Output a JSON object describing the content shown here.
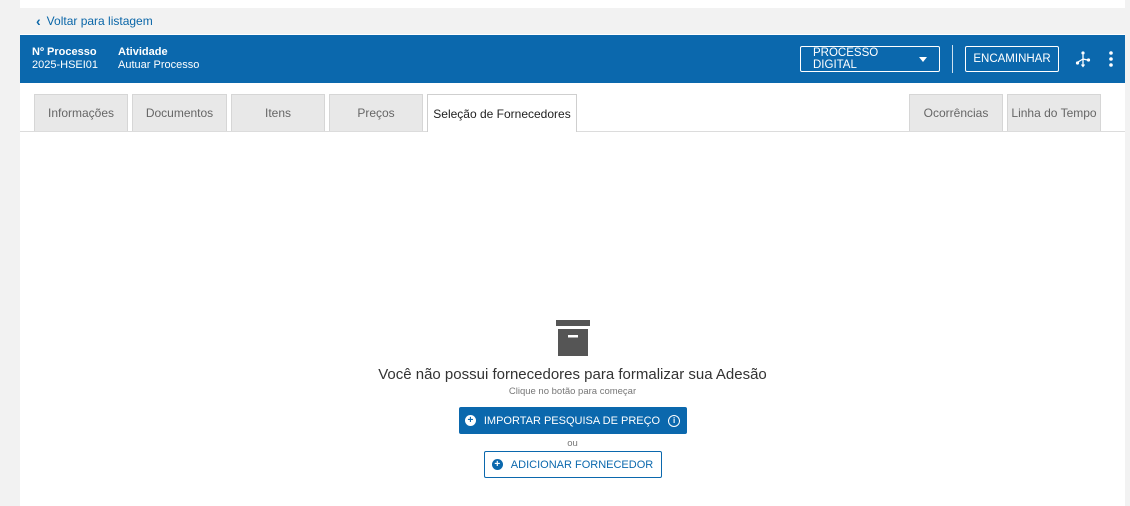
{
  "back": {
    "label": "Voltar para listagem"
  },
  "header": {
    "processo_label": "Nº Processo",
    "processo_value": "2025-HSEI01",
    "atividade_label": "Atividade",
    "atividade_value": "Autuar Processo",
    "digital_button": "PROCESSO DIGITAL",
    "forward_button": "ENCAMINHAR"
  },
  "tabs": [
    {
      "label": "Informações"
    },
    {
      "label": "Documentos"
    },
    {
      "label": "Itens"
    },
    {
      "label": "Preços"
    },
    {
      "label": "Seleção de Fornecedores",
      "active": true
    },
    {
      "label": "Ocorrências"
    },
    {
      "label": "Linha do Tempo"
    }
  ],
  "empty": {
    "title": "Você não possui fornecedores para formalizar sua Adesão",
    "subtitle": "Clique no botão para começar",
    "import_button": "IMPORTAR PESQUISA DE PREÇO",
    "or_text": "ou",
    "add_button": "ADICIONAR FORNECEDOR"
  },
  "colors": {
    "primary": "#0b68ad",
    "background": "#f2f2f2",
    "tab_inactive": "#e8e8e8"
  },
  "icons": [
    "chevron-left-icon",
    "caret-down-icon",
    "flow-icon",
    "kebab-menu-icon",
    "archive-box-icon",
    "plus-circle-icon",
    "info-icon"
  ]
}
